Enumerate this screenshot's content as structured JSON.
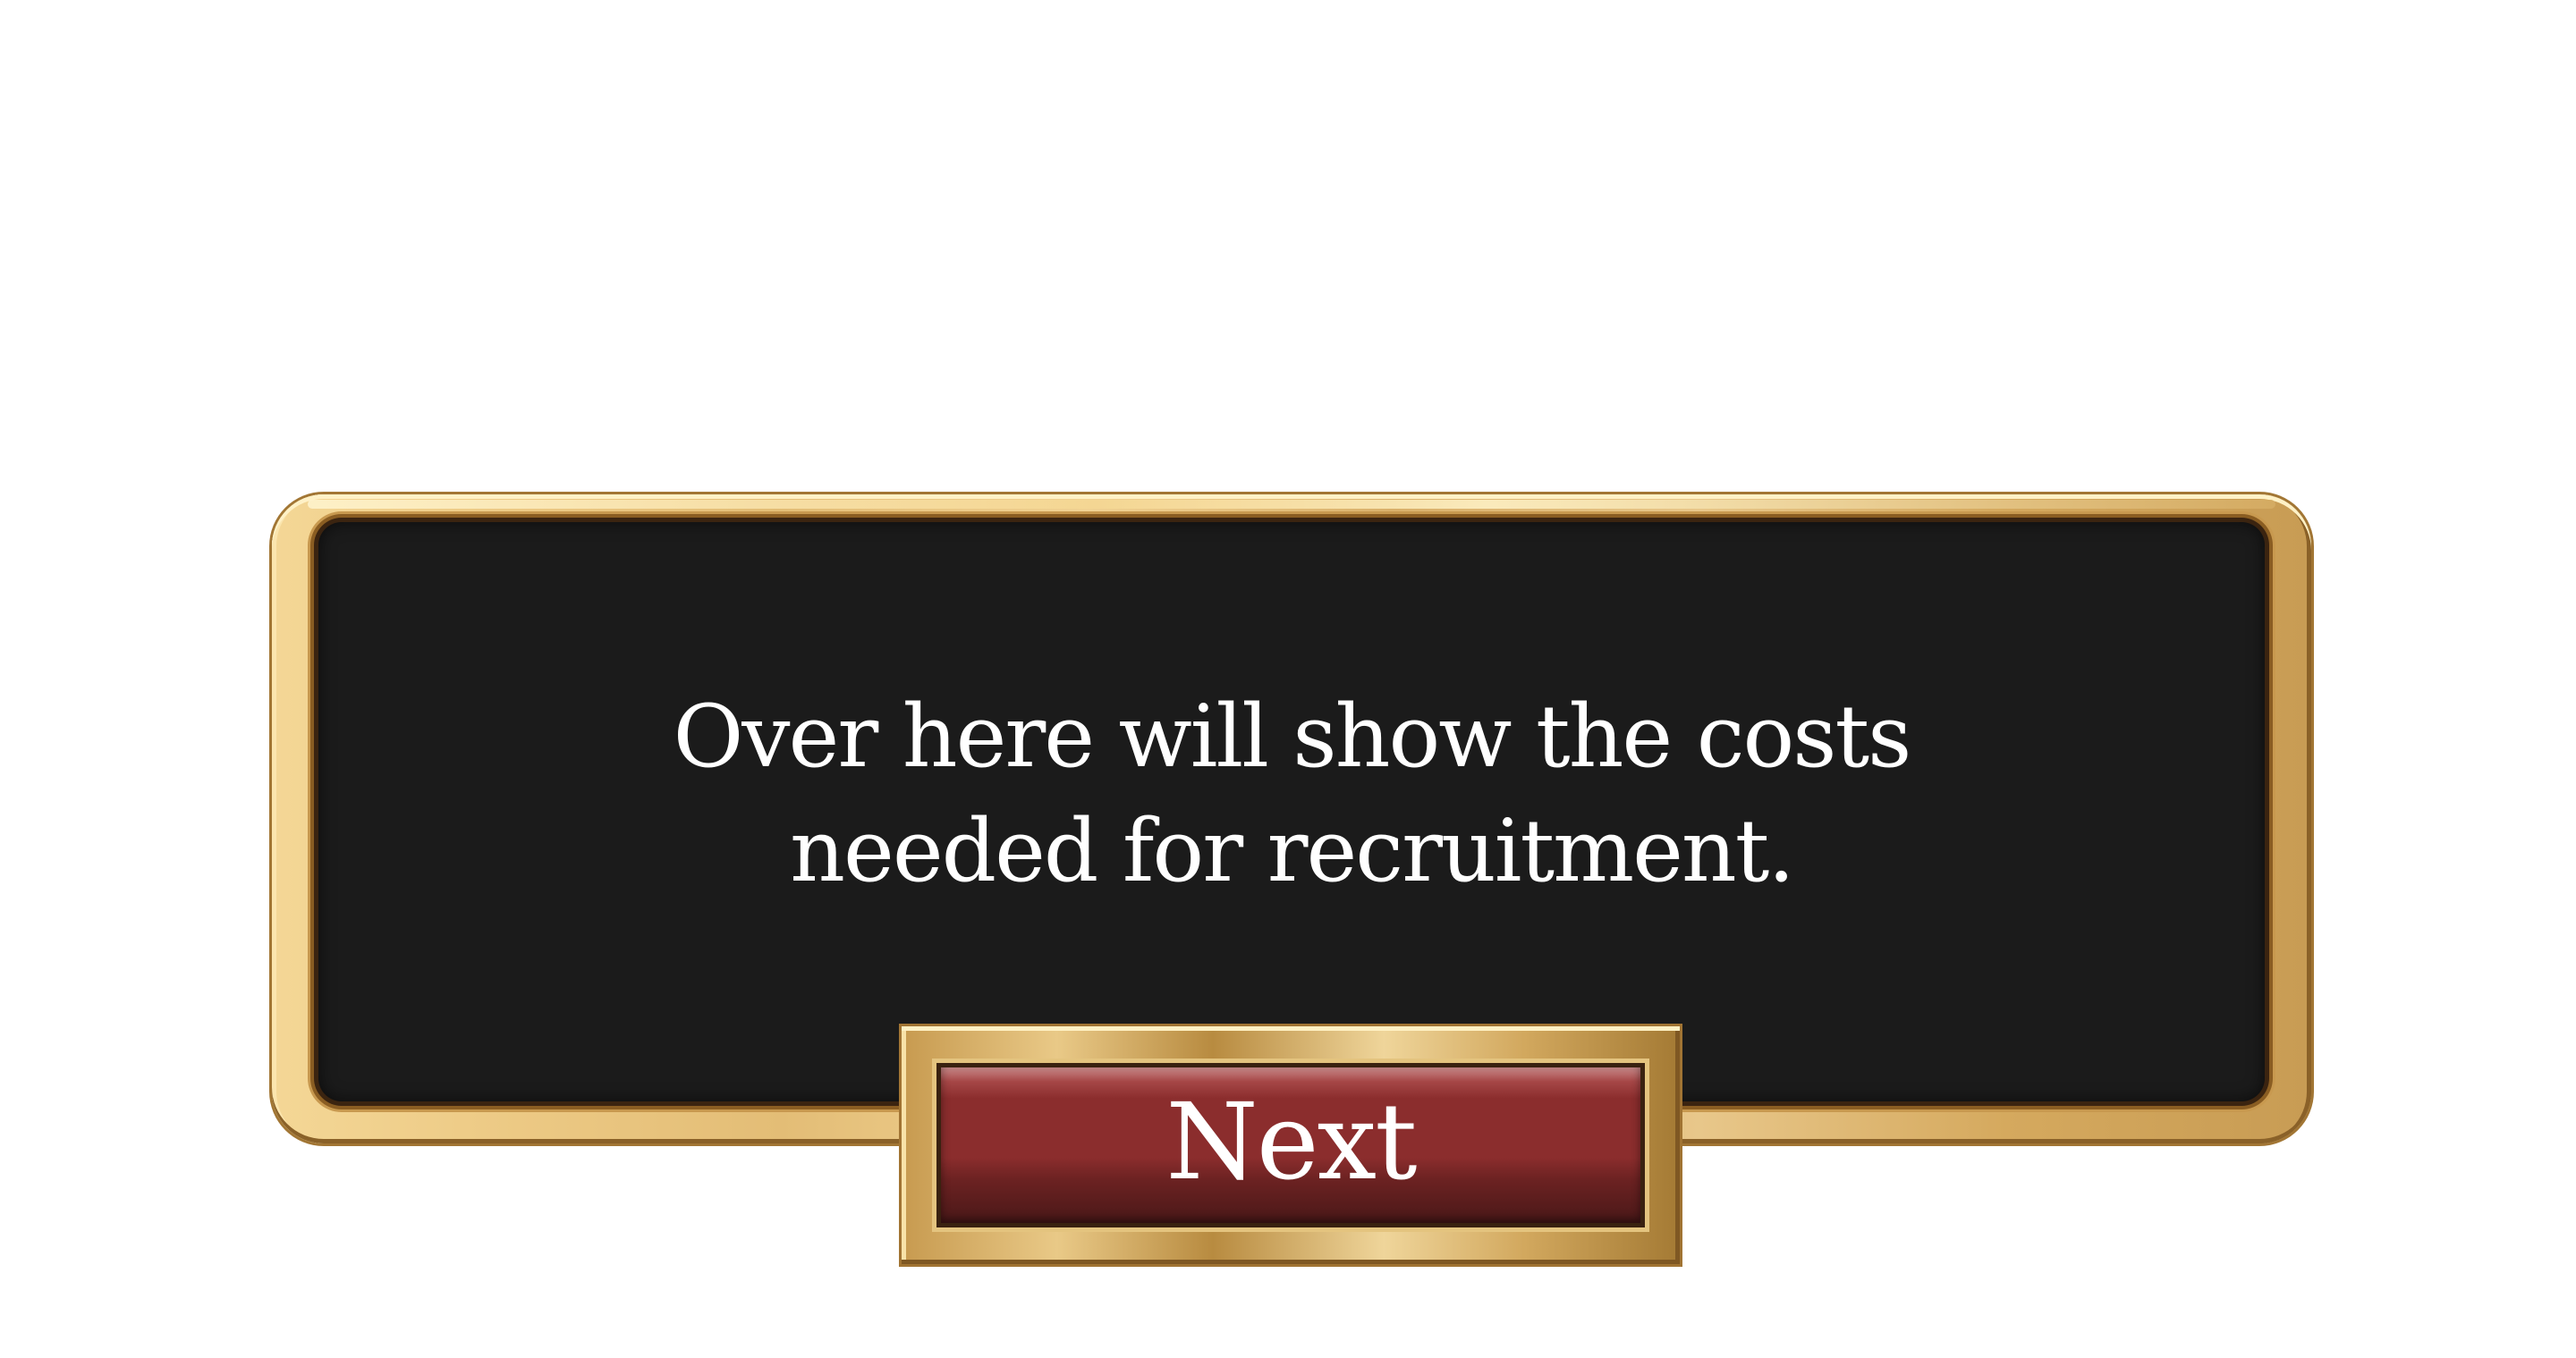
{
  "dialog": {
    "message": "Over here will show the costs\nneeded for recruitment."
  },
  "next_button": {
    "label": "Next"
  },
  "colors": {
    "panel": "#1b1b1b",
    "gold": "#e3bd76",
    "button_red": "#8b2d2d",
    "text": "#ffffff"
  }
}
